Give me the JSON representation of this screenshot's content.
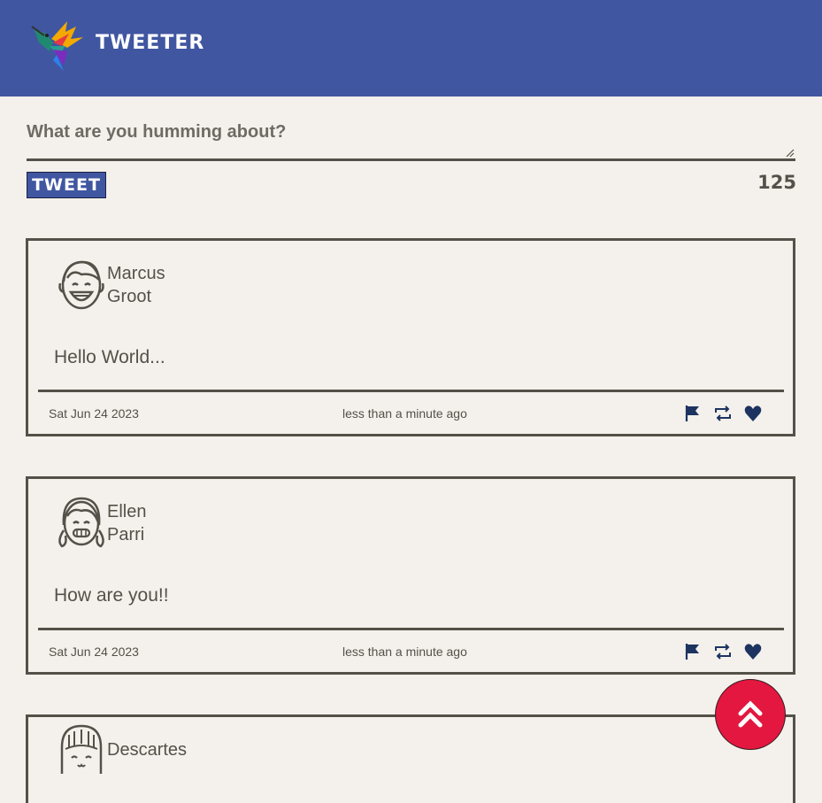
{
  "nav": {
    "brand": "TWEETER",
    "logo_icon": "hummingbird-logo-icon"
  },
  "composer": {
    "placeholder": "What are you humming about?",
    "value": "",
    "button_label": "TWEET",
    "char_counter": "125"
  },
  "tweets": [
    {
      "first_name": "Marcus",
      "last_name": "Groot",
      "avatar_icon": "boy-avatar-icon",
      "text": "Hello World...",
      "date": "Sat Jun 24 2023",
      "relative_time": "less than a minute ago"
    },
    {
      "first_name": "Ellen",
      "last_name": "Parri",
      "avatar_icon": "girl-avatar-icon",
      "text": "How are you!!",
      "date": "Sat Jun 24 2023",
      "relative_time": "less than a minute ago"
    },
    {
      "first_name": "Descartes",
      "last_name": "",
      "avatar_icon": "bangs-avatar-icon",
      "text": "",
      "date": "",
      "relative_time": ""
    }
  ],
  "colors": {
    "nav_bg": "#4056a1",
    "page_bg": "#f4f1ec",
    "text": "#545149",
    "icon": "#1d3461",
    "scroll_button": "#e3173f"
  },
  "scroll_top_icon": "double-chevron-up-icon"
}
